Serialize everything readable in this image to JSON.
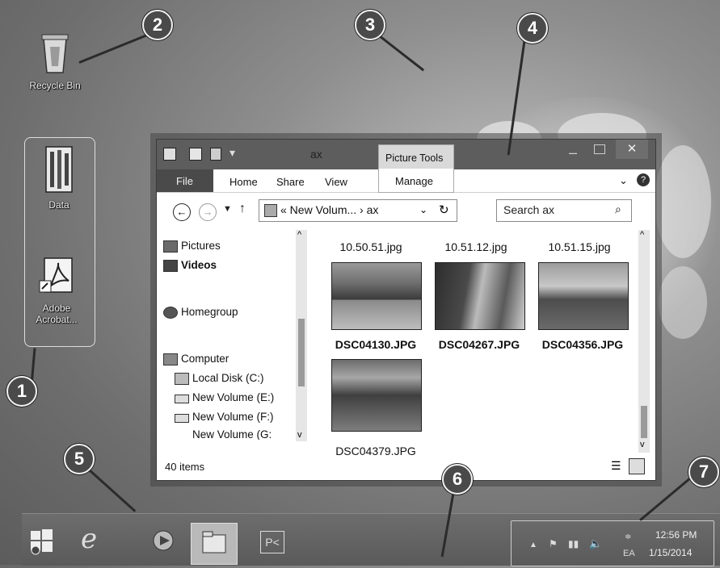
{
  "desktop": {
    "icons": [
      {
        "label": "Recycle Bin",
        "icon": "recycle-bin-icon"
      },
      {
        "label": "Data",
        "icon": "folder-icon"
      },
      {
        "label": "Adobe Acrobat...",
        "icon": "adobe-acrobat-icon"
      }
    ]
  },
  "callouts": [
    "1",
    "2",
    "3",
    "4",
    "5",
    "6",
    "7"
  ],
  "window": {
    "title": "ax",
    "contextual_tab": "Picture Tools",
    "ribbon_tabs": [
      "File",
      "Home",
      "Share",
      "View",
      "Manage"
    ],
    "address_path": "« New Volum... › ax",
    "search_placeholder": "Search ax",
    "nav_items": [
      {
        "label": "Pictures",
        "icon": "pictures-icon"
      },
      {
        "label": "Videos",
        "icon": "videos-icon"
      },
      {
        "label": "Homegroup",
        "icon": "homegroup-icon"
      },
      {
        "label": "Computer",
        "icon": "computer-icon"
      },
      {
        "label": "Local Disk (C:)",
        "icon": "local-disk-icon"
      },
      {
        "label": "New Volume (E:)",
        "icon": "drive-icon"
      },
      {
        "label": "New Volume (F:)",
        "icon": "drive-icon"
      },
      {
        "label": "New Volume (G:",
        "icon": "drive-icon"
      }
    ],
    "top_files": [
      "10.50.51.jpg",
      "10.51.12.jpg",
      "10.51.15.jpg"
    ],
    "files": [
      "DSC04130.JPG",
      "DSC04267.JPG",
      "DSC04356.JPG",
      "DSC04379.JPG"
    ],
    "status": "40 items"
  },
  "taskbar": {
    "clock_time": "12:56 PM",
    "clock_date": "1/15/2014",
    "ime": "EA",
    "apps": [
      "Internet Explorer",
      "Media Player",
      "File Explorer",
      "Photoshop"
    ]
  },
  "colors": {
    "window_title": "#5d5d5d",
    "desktop": "#7a7a7a",
    "callout": "#4a4a4a"
  }
}
